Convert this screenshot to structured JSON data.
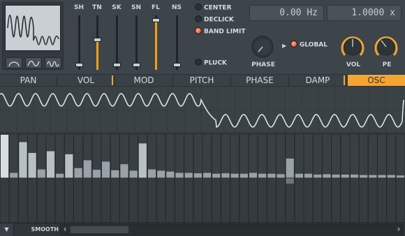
{
  "faders": [
    {
      "label": "SH",
      "level": 0.05
    },
    {
      "label": "TN",
      "level": 0.55
    },
    {
      "label": "SK",
      "level": 0.05
    },
    {
      "label": "SN",
      "level": 0.05
    },
    {
      "label": "FL",
      "level": 0.95
    },
    {
      "label": "NS",
      "level": 0.05
    }
  ],
  "options": [
    {
      "label": "CENTER",
      "on": false
    },
    {
      "label": "DECLICK",
      "on": false
    },
    {
      "label": "BAND LIMIT",
      "on": true
    },
    {
      "label": "PLUCK",
      "on": false
    }
  ],
  "displays": {
    "frequency": "0.00 Hz",
    "ratio": "1.0000 x"
  },
  "knobs": {
    "phase": "PHASE",
    "global": "GLOBAL",
    "vol": "VOL",
    "pe": "PE"
  },
  "global_on": true,
  "tabs": [
    "PAN",
    "VOL",
    "MOD",
    "PITCH",
    "PHASE",
    "DAMP",
    "OSC"
  ],
  "active_tab": "OSC",
  "harmonics": [
    1.0,
    0.12,
    0.83,
    0.58,
    0.2,
    0.62,
    0.1,
    0.55,
    0.23,
    0.41,
    0.19,
    0.38,
    0.18,
    0.32,
    0.17,
    0.8,
    0.2,
    0.17,
    0.15,
    0.12,
    0.12,
    0.11,
    0.12,
    0.1,
    0.11,
    0.1,
    0.1,
    0.12,
    0.1,
    0.1,
    0.09,
    0.45,
    0.1,
    0.1,
    0.08,
    0.09,
    0.08,
    0.08,
    0.08,
    0.07,
    0.07,
    0.07,
    0.07,
    0.06
  ],
  "harmonic_dip_index": 31,
  "bottom": {
    "menu_icon": "▼",
    "smooth_label": "SMOOTH",
    "scroll_left": "‹",
    "scroll_right": "›"
  },
  "colors": {
    "accent": "#f0a630",
    "led_on": "#f0643f",
    "wave_line": "#e8ecee",
    "bar": "#9aa2a7"
  }
}
